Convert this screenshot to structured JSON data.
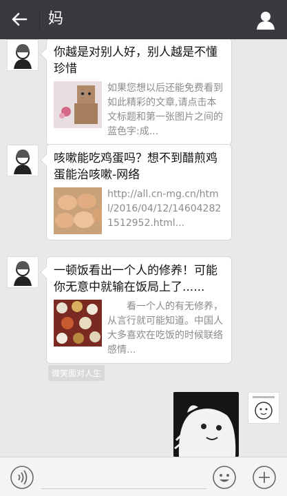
{
  "header": {
    "title": "妈"
  },
  "messages": [
    {
      "title": "你越是对别人好，别人越是不懂珍惜",
      "description": "如果您想以后还能免费看到如此精彩的文章,请点击本文标题和第一张图片之间的蓝色字:成..."
    },
    {
      "title": "咳嗽能吃鸡蛋吗？想不到醋煎鸡蛋能治咳嗽-网络",
      "description": "http://all.cn-mg.cn/html/2016/04/12/146042821512952.html..."
    },
    {
      "title": "一顿饭看出一个人的修养！可能你无意中就输在饭局上了......",
      "description": "看一个人的有无修养，从言行就可能知道。中国人大多喜欢在吃饭的时候联络感情..."
    }
  ],
  "status_note": "微笑面对人生",
  "colors": {
    "topbar": "#393a3f",
    "chat_background": "#e9e9e9",
    "bubble": "#ffffff",
    "link_gray": "#8b8b8b"
  },
  "icons": {
    "back": "arrow-left-icon",
    "profile": "person-icon",
    "voice": "voice-icon",
    "emoji": "smiley-icon",
    "plus": "plus-icon"
  }
}
